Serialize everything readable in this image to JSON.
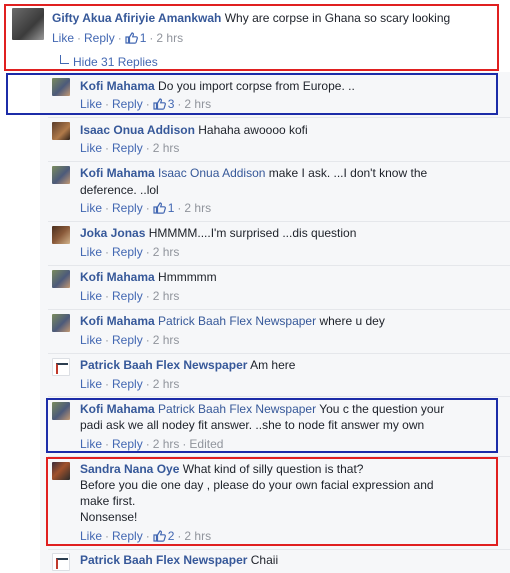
{
  "main_comment": {
    "author": "Gifty Akua Afiriyie Amankwah",
    "text": "Why are corpse in Ghana so scary looking",
    "like_label": "Like",
    "reply_label": "Reply",
    "likes": "1",
    "time": "2 hrs"
  },
  "hide_replies_label": "Hide 31 Replies",
  "replies": [
    {
      "author": "Kofi Mahama",
      "text": "Do you import corpse from Europe. ..",
      "likes": "3",
      "time": "2 hrs"
    },
    {
      "author": "Isaac Onua Addison",
      "text": "Hahaha awoooo kofi",
      "time": "2 hrs"
    },
    {
      "author": "Kofi Mahama",
      "tag": "Isaac Onua Addison",
      "text_line1": "make I ask. ...I don't know the",
      "text_line2": "deference. ..lol",
      "likes": "1",
      "time": "2 hrs"
    },
    {
      "author": "Joka Jonas",
      "text": "HMMMM....I'm surprised ...dis question",
      "time": "2 hrs"
    },
    {
      "author": "Kofi Mahama",
      "text": "Hmmmmm",
      "time": "2 hrs"
    },
    {
      "author": "Kofi Mahama",
      "tag": "Patrick Baah Flex Newspaper",
      "text": "where u dey",
      "time": "2 hrs"
    },
    {
      "author": "Patrick Baah Flex Newspaper",
      "text": "Am here",
      "time": "2 hrs"
    },
    {
      "author": "Kofi Mahama",
      "tag": "Patrick Baah Flex Newspaper",
      "text_line1": "You c the question your",
      "text_line2": "padi ask we all nodey fit answer. ..she to node fit answer my own",
      "time": "2 hrs",
      "edited": "Edited"
    },
    {
      "author": "Sandra Nana Oye",
      "text_line1": "What kind of silly question is that?",
      "text_line2": "Before you die one day , please do your own facial expression and",
      "text_line3": "make first.",
      "text_line4": "Nonsense!",
      "likes": "2",
      "time": "2 hrs"
    },
    {
      "author": "Patrick Baah Flex Newspaper",
      "text": "Chaii"
    }
  ],
  "labels": {
    "like": "Like",
    "reply": "Reply"
  },
  "colors": {
    "link": "#4267b2",
    "name": "#365899",
    "meta": "#90949c",
    "highlight_red": "#e02020",
    "highlight_blue": "#1c2ca8"
  },
  "icons": [
    "thumbs-up-icon",
    "avatar"
  ]
}
